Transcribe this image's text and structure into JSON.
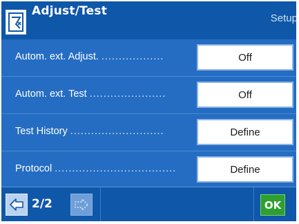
{
  "header": {
    "title": "Adjust/Test",
    "right_label": "Setup",
    "icon": "adjust-test-icon"
  },
  "rows": [
    {
      "label": "Autom. ext. Adjust.",
      "dots": "..................",
      "value": "Off"
    },
    {
      "label": "Autom. ext. Test",
      "dots": "......................",
      "value": "Off"
    },
    {
      "label": "Test History",
      "dots": "...........................",
      "value": "Define"
    },
    {
      "label": "Protocol",
      "dots": "...................................",
      "value": "Define"
    }
  ],
  "footer": {
    "prev_icon": "arrow-left-icon",
    "page_indicator": "2/2",
    "next_icon": "arrow-right-icon",
    "ok_label": "OK"
  },
  "colors": {
    "header_bg": "#0f57a8",
    "list_bg": "#246dc3",
    "ok_bg": "#2f9f2f"
  }
}
